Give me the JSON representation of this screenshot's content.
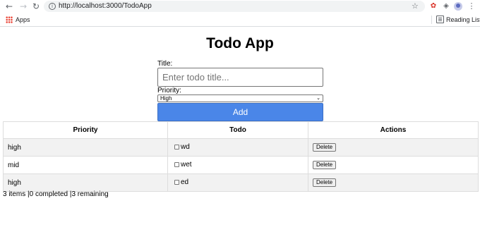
{
  "browser": {
    "url": "http://localhost:3000/TodoApp",
    "bookmarks": {
      "apps_label": "Apps",
      "reading_list_label": "Reading List"
    }
  },
  "app": {
    "title": "Todo App",
    "form": {
      "title_label": "Title:",
      "title_placeholder": "Enter todo title...",
      "title_value": "",
      "priority_label": "Priority:",
      "priority_selected": "High",
      "add_label": "Add"
    },
    "table": {
      "headers": [
        "Priority",
        "Todo",
        "Actions"
      ],
      "rows": [
        {
          "priority": "high",
          "todo": "wd",
          "completed": false,
          "action": "Delete"
        },
        {
          "priority": "mid",
          "todo": "wet",
          "completed": false,
          "action": "Delete"
        },
        {
          "priority": "high",
          "todo": "ed",
          "completed": false,
          "action": "Delete"
        }
      ]
    },
    "summary": "3 items |0 completed |3 remaining"
  },
  "colors": {
    "add_button": "#4a86e8",
    "row_stripe": "#f2f2f2",
    "extension_icon": "#d93025"
  },
  "icons": [
    "back-icon",
    "forward-icon",
    "reload-icon",
    "info-icon",
    "star-icon",
    "extension-icon",
    "puzzle-icon",
    "profile-icon",
    "menu-icon",
    "apps-icon",
    "reading-list-icon"
  ]
}
